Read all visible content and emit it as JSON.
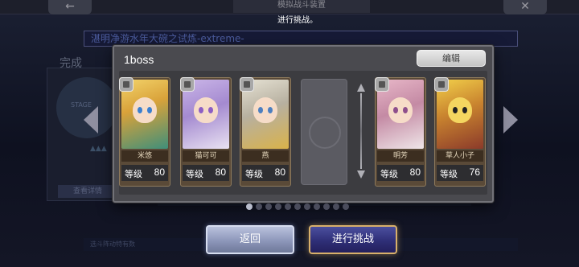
{
  "background": {
    "screen_title": "模拟战斗装置",
    "stage_banner": "湛明净游水年大碗之试炼-extreme-",
    "status_label": "完成",
    "stage_label": "STAGE",
    "view_details": "查看详情",
    "bottom_hint": "选斗阵动特有数"
  },
  "toast": "进行挑战。",
  "dialog": {
    "team_name": "1boss",
    "edit_label": "编辑"
  },
  "level_label": "等级",
  "characters": [
    {
      "name": "米悠",
      "level": "80"
    },
    {
      "name": "猫可可",
      "level": "80"
    },
    {
      "name": "燕",
      "level": "80"
    },
    {
      "name": "明芳",
      "level": "80"
    },
    {
      "name": "草人小子",
      "level": "76"
    }
  ],
  "pagination": {
    "total": 11,
    "active_index": 0
  },
  "buttons": {
    "return_label": "返回",
    "challenge_label": "进行挑战"
  },
  "colors": {
    "dialog_bg": "#4a4a4f",
    "challenge_border": "#d8b06a"
  }
}
